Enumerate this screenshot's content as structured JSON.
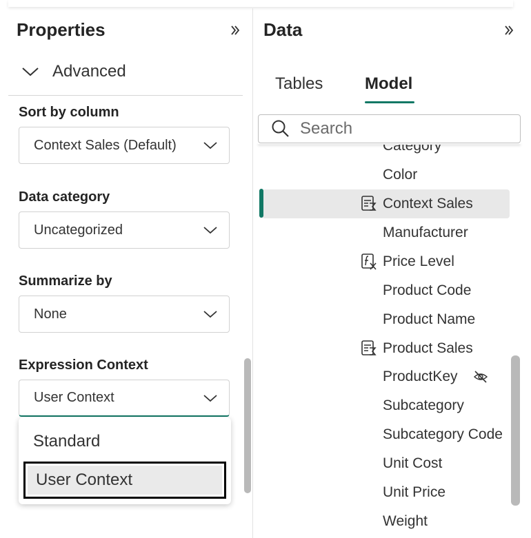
{
  "properties": {
    "title": "Properties",
    "advanced_label": "Advanced",
    "sort_by": {
      "label": "Sort by column",
      "value": "Context Sales (Default)"
    },
    "data_category": {
      "label": "Data category",
      "value": "Uncategorized"
    },
    "summarize_by": {
      "label": "Summarize by",
      "value": "None"
    },
    "expression_context": {
      "label": "Expression Context",
      "value": "User Context",
      "options": [
        "Standard",
        "User Context"
      ]
    }
  },
  "data_pane": {
    "title": "Data",
    "tabs": [
      "Tables",
      "Model"
    ],
    "active_tab": "Model",
    "search_placeholder": "Search",
    "partial_item": "Category",
    "fields": [
      {
        "name": "Color",
        "icon": ""
      },
      {
        "name": "Context Sales",
        "icon": "calc-column-icon",
        "selected": true
      },
      {
        "name": "Manufacturer",
        "icon": ""
      },
      {
        "name": "Price Level",
        "icon": "calc-fx-icon"
      },
      {
        "name": "Product Code",
        "icon": ""
      },
      {
        "name": "Product Name",
        "icon": ""
      },
      {
        "name": "Product Sales",
        "icon": "calc-column-icon"
      },
      {
        "name": "ProductKey",
        "icon": "",
        "hidden": true
      },
      {
        "name": "Subcategory",
        "icon": ""
      },
      {
        "name": "Subcategory Code",
        "icon": ""
      },
      {
        "name": "Unit Cost",
        "icon": ""
      },
      {
        "name": "Unit Price",
        "icon": ""
      },
      {
        "name": "Weight",
        "icon": ""
      }
    ]
  },
  "colors": {
    "accent": "#117865"
  }
}
